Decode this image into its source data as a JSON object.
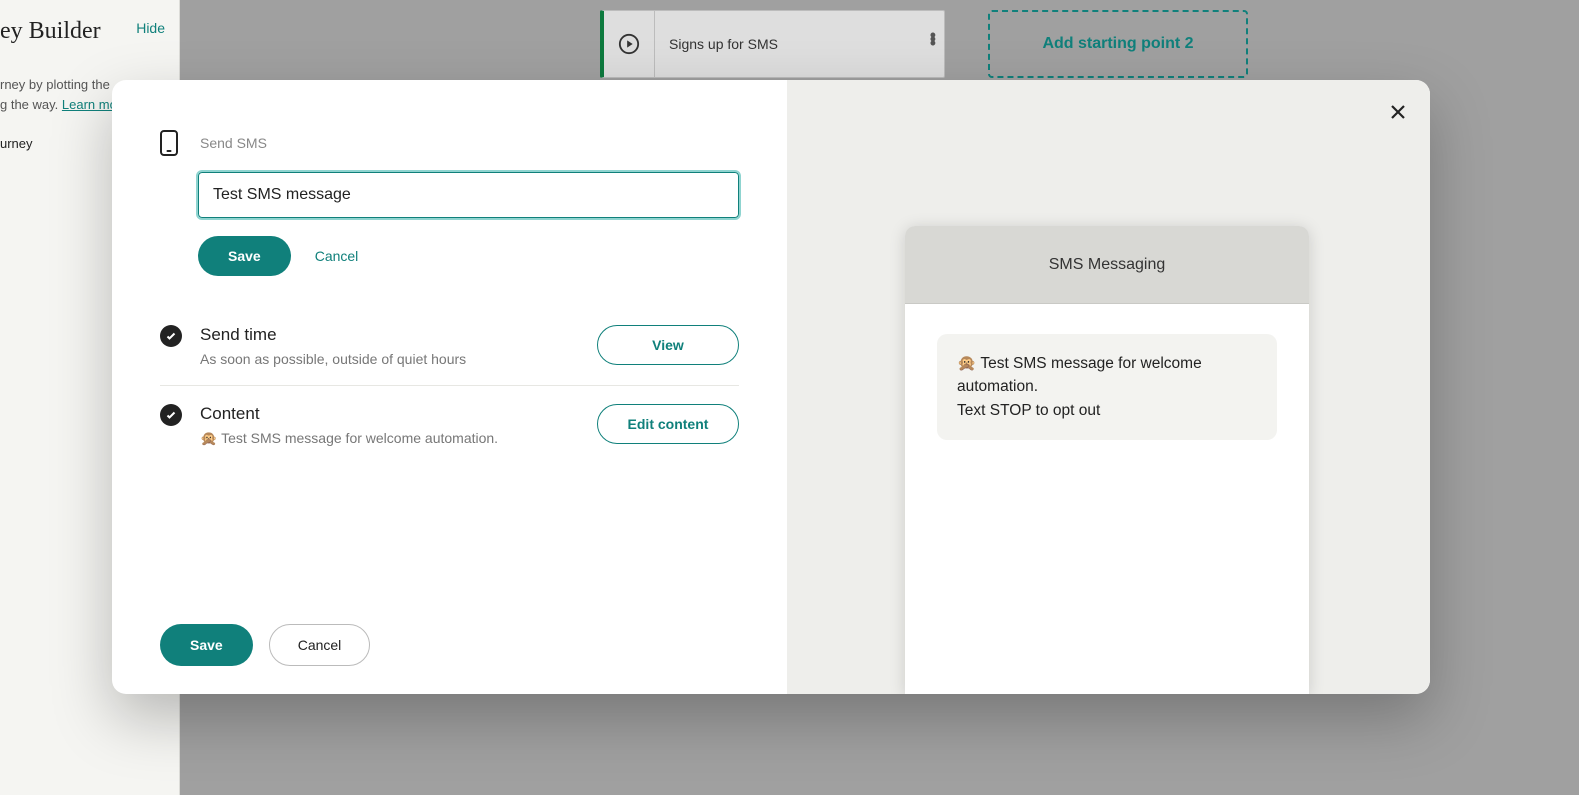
{
  "sidebar": {
    "title": "ey Builder",
    "hide": "Hide",
    "desc_part1": "rney by plotting the",
    "desc_part2": "g the way. ",
    "learn_more": "Learn mo",
    "subline": "urney"
  },
  "canvas": {
    "start_card_label": "Signs up for SMS",
    "add_start_label": "Add starting point 2"
  },
  "modal": {
    "subtitle": "Send SMS",
    "name_value": "Test SMS message",
    "inline_save": "Save",
    "inline_cancel": "Cancel",
    "sections": {
      "send_time": {
        "title": "Send time",
        "sub": "As soon as possible, outside of quiet hours",
        "action": "View"
      },
      "content": {
        "title": "Content",
        "sub": "🙊 Test SMS message for welcome automation.",
        "action": "Edit content"
      }
    },
    "footer_save": "Save",
    "footer_cancel": "Cancel",
    "preview": {
      "header": "SMS Messaging",
      "bubble": "🙊 Test SMS message for welcome automation.\nText STOP to opt out"
    }
  }
}
